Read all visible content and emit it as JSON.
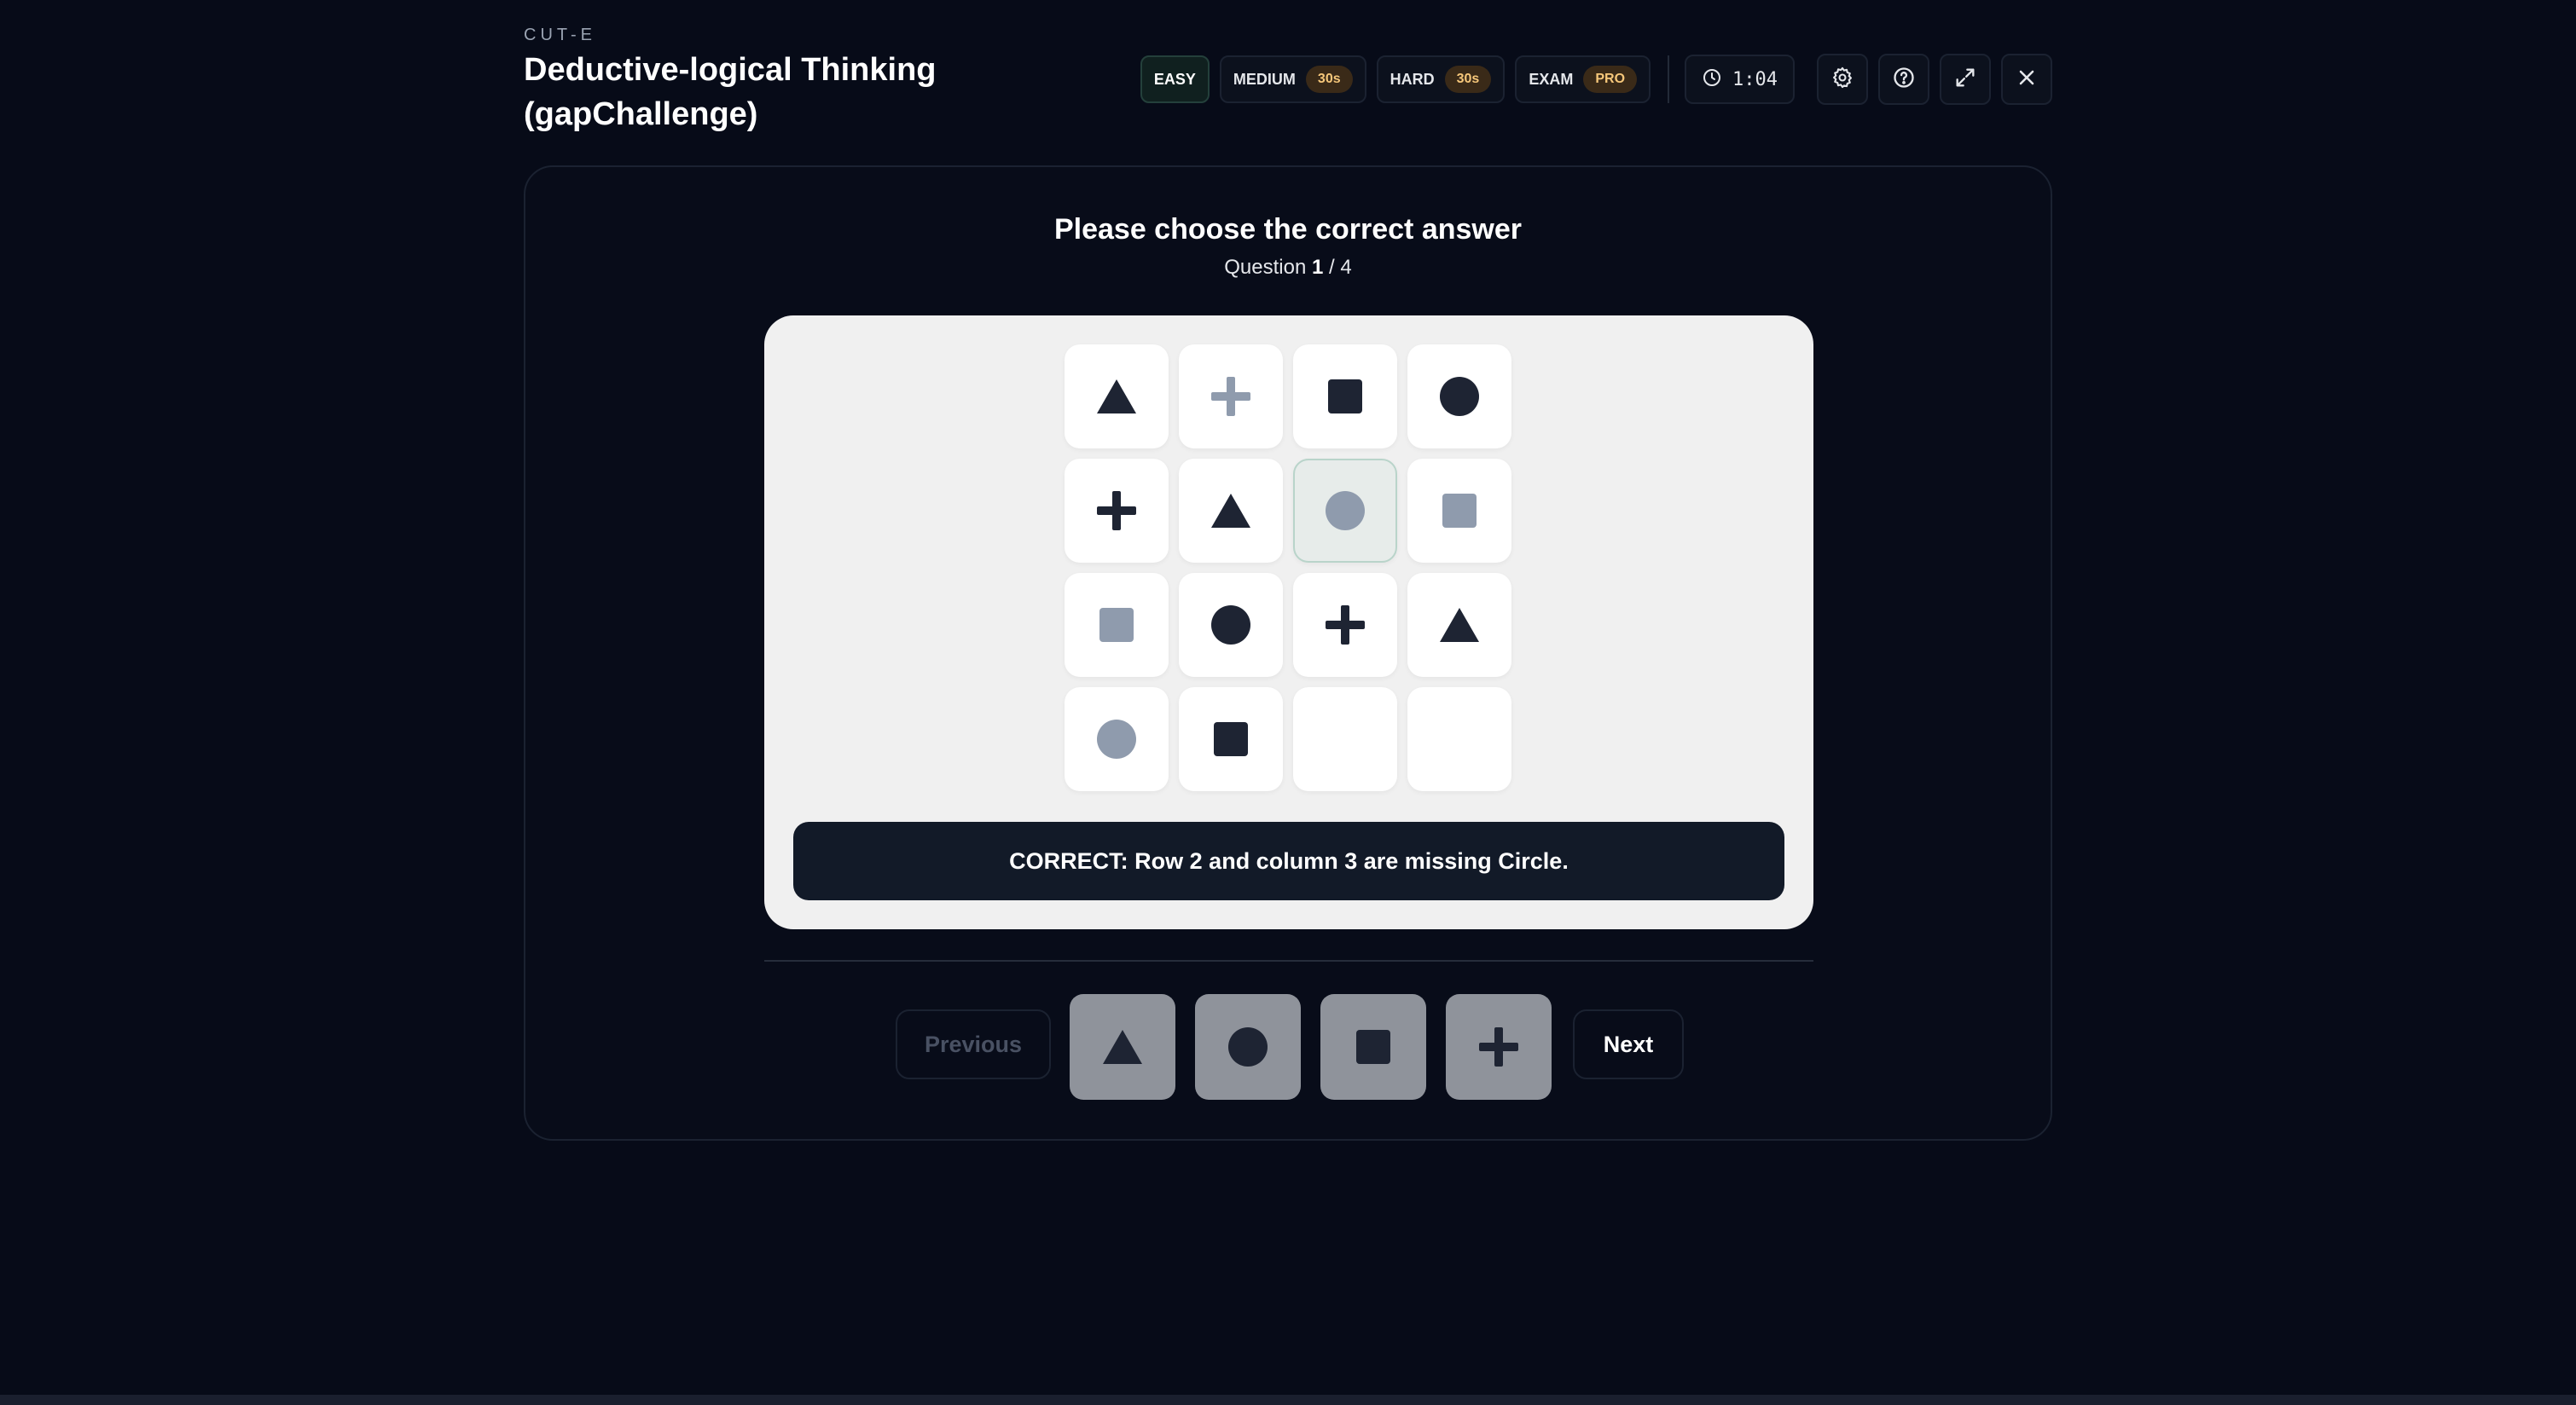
{
  "app": {
    "brand": "CUT-E",
    "title": "Deductive-logical Thinking (gapChallenge)"
  },
  "difficulty": [
    {
      "label": "EASY",
      "badge": null,
      "active": true
    },
    {
      "label": "MEDIUM",
      "badge": "30s",
      "active": false
    },
    {
      "label": "HARD",
      "badge": "30s",
      "active": false
    },
    {
      "label": "EXAM",
      "badge": "PRO",
      "active": false
    }
  ],
  "timer": {
    "value": "1:04",
    "icon": "clock-icon"
  },
  "toolbar_icons": [
    "settings-icon",
    "help-icon",
    "fullscreen-icon",
    "close-icon"
  ],
  "question": {
    "heading": "Please choose the correct answer",
    "prefix": "Question",
    "current": "1",
    "total": "/ 4"
  },
  "grid": {
    "rows": [
      [
        {
          "shape": "triangle",
          "tone": "dark"
        },
        {
          "shape": "plus",
          "tone": "light"
        },
        {
          "shape": "square",
          "tone": "dark"
        },
        {
          "shape": "circle",
          "tone": "dark"
        }
      ],
      [
        {
          "shape": "plus",
          "tone": "dark"
        },
        {
          "shape": "triangle",
          "tone": "dark"
        },
        {
          "shape": "circle",
          "tone": "light",
          "highlight": true
        },
        {
          "shape": "square",
          "tone": "light"
        }
      ],
      [
        {
          "shape": "square",
          "tone": "light"
        },
        {
          "shape": "circle",
          "tone": "dark"
        },
        {
          "shape": "plus",
          "tone": "dark"
        },
        {
          "shape": "triangle",
          "tone": "dark"
        }
      ],
      [
        {
          "shape": "circle",
          "tone": "light"
        },
        {
          "shape": "square",
          "tone": "dark"
        },
        {
          "shape": null
        },
        {
          "shape": null
        }
      ]
    ]
  },
  "feedback": "CORRECT: Row 2 and column 3 are missing Circle.",
  "navigation": {
    "previous": "Previous",
    "next": "Next"
  },
  "answer_options": [
    "triangle",
    "circle",
    "square",
    "plus"
  ],
  "colors": {
    "shape_dark": "#1e2433",
    "shape_light": "#8f9bad",
    "option_bg": "#8f939b",
    "pill_bg": "#3a2a18",
    "pill_text": "#f6c77a"
  }
}
